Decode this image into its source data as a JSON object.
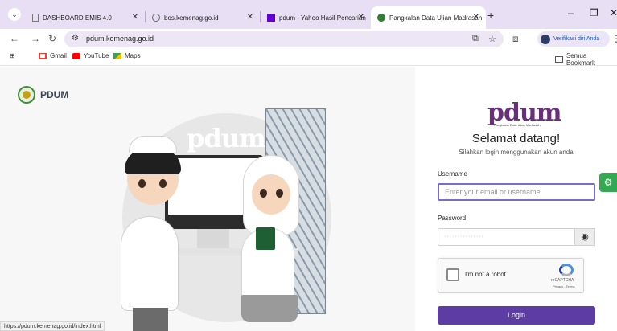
{
  "browser": {
    "tabs": [
      {
        "label": "DASHBOARD EMIS 4.0",
        "active": false
      },
      {
        "label": "bos.kemenag.go.id",
        "active": false
      },
      {
        "label": "pdum - Yahoo Hasil Pencarian",
        "active": false
      },
      {
        "label": "Pangkalan Data Ujian Madrasah",
        "active": true
      }
    ],
    "url": "pdum.kemenag.go.id",
    "profile_label": "Verifikasi diri Anda",
    "bookmarks": [
      {
        "label": "Gmail",
        "icon": "gmail-icon",
        "color": "#ea4335"
      },
      {
        "label": "YouTube",
        "icon": "youtube-icon",
        "color": "#ff0000"
      },
      {
        "label": "Maps",
        "icon": "maps-icon",
        "color": "#34a853"
      }
    ],
    "all_bookmarks_label": "Semua Bookmark",
    "status_url": "https://pdum.kemenag.go.id/index.html"
  },
  "hero": {
    "brand": "PDUM",
    "logo_text": "pdum"
  },
  "login": {
    "logo_text": "pdum",
    "logo_subtitle": "Pangkalan Data Ujian Madrasah",
    "welcome": "Selamat datang!",
    "subtitle": "Silahkan login menggunakan akun anda",
    "username_label": "Username",
    "username_placeholder": "Enter your email or username",
    "password_label": "Password",
    "password_placeholder": "···············",
    "recaptcha_label": "I'm not a robot",
    "recaptcha_brand": "reCAPTCHA",
    "recaptcha_terms": "Privacy - Terms",
    "login_button": "Login"
  },
  "colors": {
    "accent": "#5d3ca3",
    "tabstrip": "#e8dff4",
    "focus_border": "#7a6cc9",
    "fab": "#35a853"
  }
}
